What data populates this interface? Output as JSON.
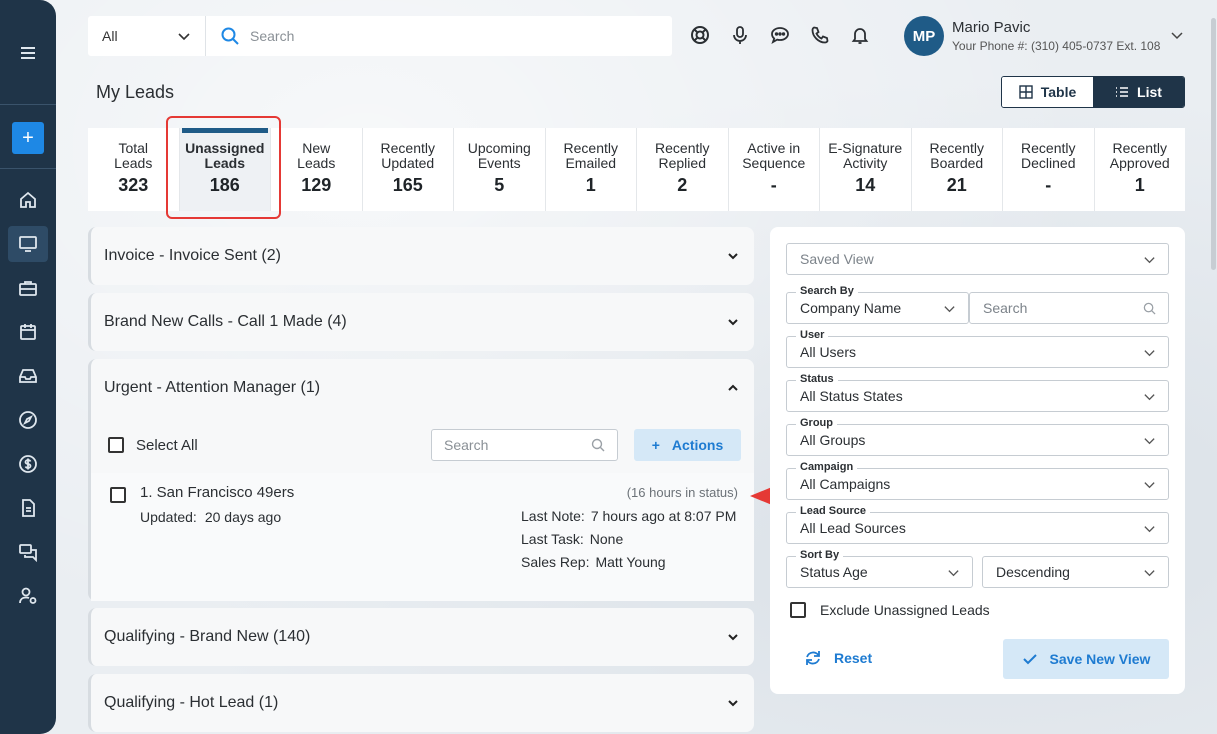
{
  "colors": {
    "sidebar": "#1f3448",
    "accent": "#1e88e5",
    "highlight": "#e53935",
    "selected_bar": "#1f5b87"
  },
  "sidebar": {
    "add_label": "+",
    "items": [
      {
        "icon": "menu-icon"
      },
      {
        "icon": "home-icon"
      },
      {
        "icon": "monitor-icon"
      },
      {
        "icon": "briefcase-icon"
      },
      {
        "icon": "calendar-icon"
      },
      {
        "icon": "inbox-icon"
      },
      {
        "icon": "compass-icon"
      },
      {
        "icon": "dollar-icon"
      },
      {
        "icon": "document-icon"
      },
      {
        "icon": "chat-icon"
      },
      {
        "icon": "user-settings-icon"
      }
    ]
  },
  "topbar": {
    "scope_value": "All",
    "search_placeholder": "Search",
    "icons": [
      "support-icon",
      "microphone-icon",
      "message-icon",
      "phone-icon",
      "bell-icon"
    ]
  },
  "user": {
    "initials": "MP",
    "name": "Mario Pavic",
    "phone": "Your Phone #: (310) 405-0737 Ext. 108"
  },
  "page": {
    "title": "My Leads"
  },
  "view_toggle": {
    "table_label": "Table",
    "list_label": "List",
    "selected": "List"
  },
  "stats": [
    {
      "label1": "Total",
      "label2": "Leads",
      "value": "323"
    },
    {
      "label1": "Unassigned",
      "label2": "Leads",
      "value": "186"
    },
    {
      "label1": "New",
      "label2": "Leads",
      "value": "129"
    },
    {
      "label1": "Recently",
      "label2": "Updated",
      "value": "165"
    },
    {
      "label1": "Upcoming",
      "label2": "Events",
      "value": "5"
    },
    {
      "label1": "Recently",
      "label2": "Emailed",
      "value": "1"
    },
    {
      "label1": "Recently",
      "label2": "Replied",
      "value": "2"
    },
    {
      "label1": "Active in",
      "label2": "Sequence",
      "value": "-"
    },
    {
      "label1": "E-Signature",
      "label2": "Activity",
      "value": "14"
    },
    {
      "label1": "Recently",
      "label2": "Boarded",
      "value": "21"
    },
    {
      "label1": "Recently",
      "label2": "Declined",
      "value": "-"
    },
    {
      "label1": "Recently",
      "label2": "Approved",
      "value": "1"
    }
  ],
  "groups": [
    {
      "title": "Invoice - Invoice Sent (2)",
      "expanded": false
    },
    {
      "title": "Brand New Calls - Call 1 Made (4)",
      "expanded": false
    },
    {
      "title": "Urgent - Attention Manager (1)",
      "expanded": true
    },
    {
      "title": "Qualifying - Brand New (140)",
      "expanded": false
    },
    {
      "title": "Qualifying - Hot Lead (1)",
      "expanded": false
    }
  ],
  "expanded_group": {
    "select_all_label": "Select All",
    "search_placeholder": "Search",
    "actions_label": "Actions",
    "lead": {
      "name": "1. San Francisco 49ers",
      "updated_label": "Updated:",
      "updated_value": "20 days ago",
      "status_time": "(16 hours in status)",
      "last_note_label": "Last Note:",
      "last_note_value": "7 hours ago at 8:07 PM",
      "last_task_label": "Last Task:",
      "last_task_value": "None",
      "sales_rep_label": "Sales Rep:",
      "sales_rep_value": "Matt Young"
    }
  },
  "filters": {
    "saved_view_placeholder": "Saved View",
    "search_by_label": "Search By",
    "search_by_value": "Company Name",
    "search_placeholder": "Search",
    "user_label": "User",
    "user_value": "All Users",
    "status_label": "Status",
    "status_value": "All Status States",
    "group_label": "Group",
    "group_value": "All Groups",
    "campaign_label": "Campaign",
    "campaign_value": "All Campaigns",
    "lead_source_label": "Lead Source",
    "lead_source_value": "All Lead Sources",
    "sort_by_label": "Sort By",
    "sort_by_value": "Status Age",
    "sort_order_value": "Descending",
    "exclude_label": "Exclude Unassigned Leads",
    "reset_label": "Reset",
    "save_label": "Save New View"
  }
}
